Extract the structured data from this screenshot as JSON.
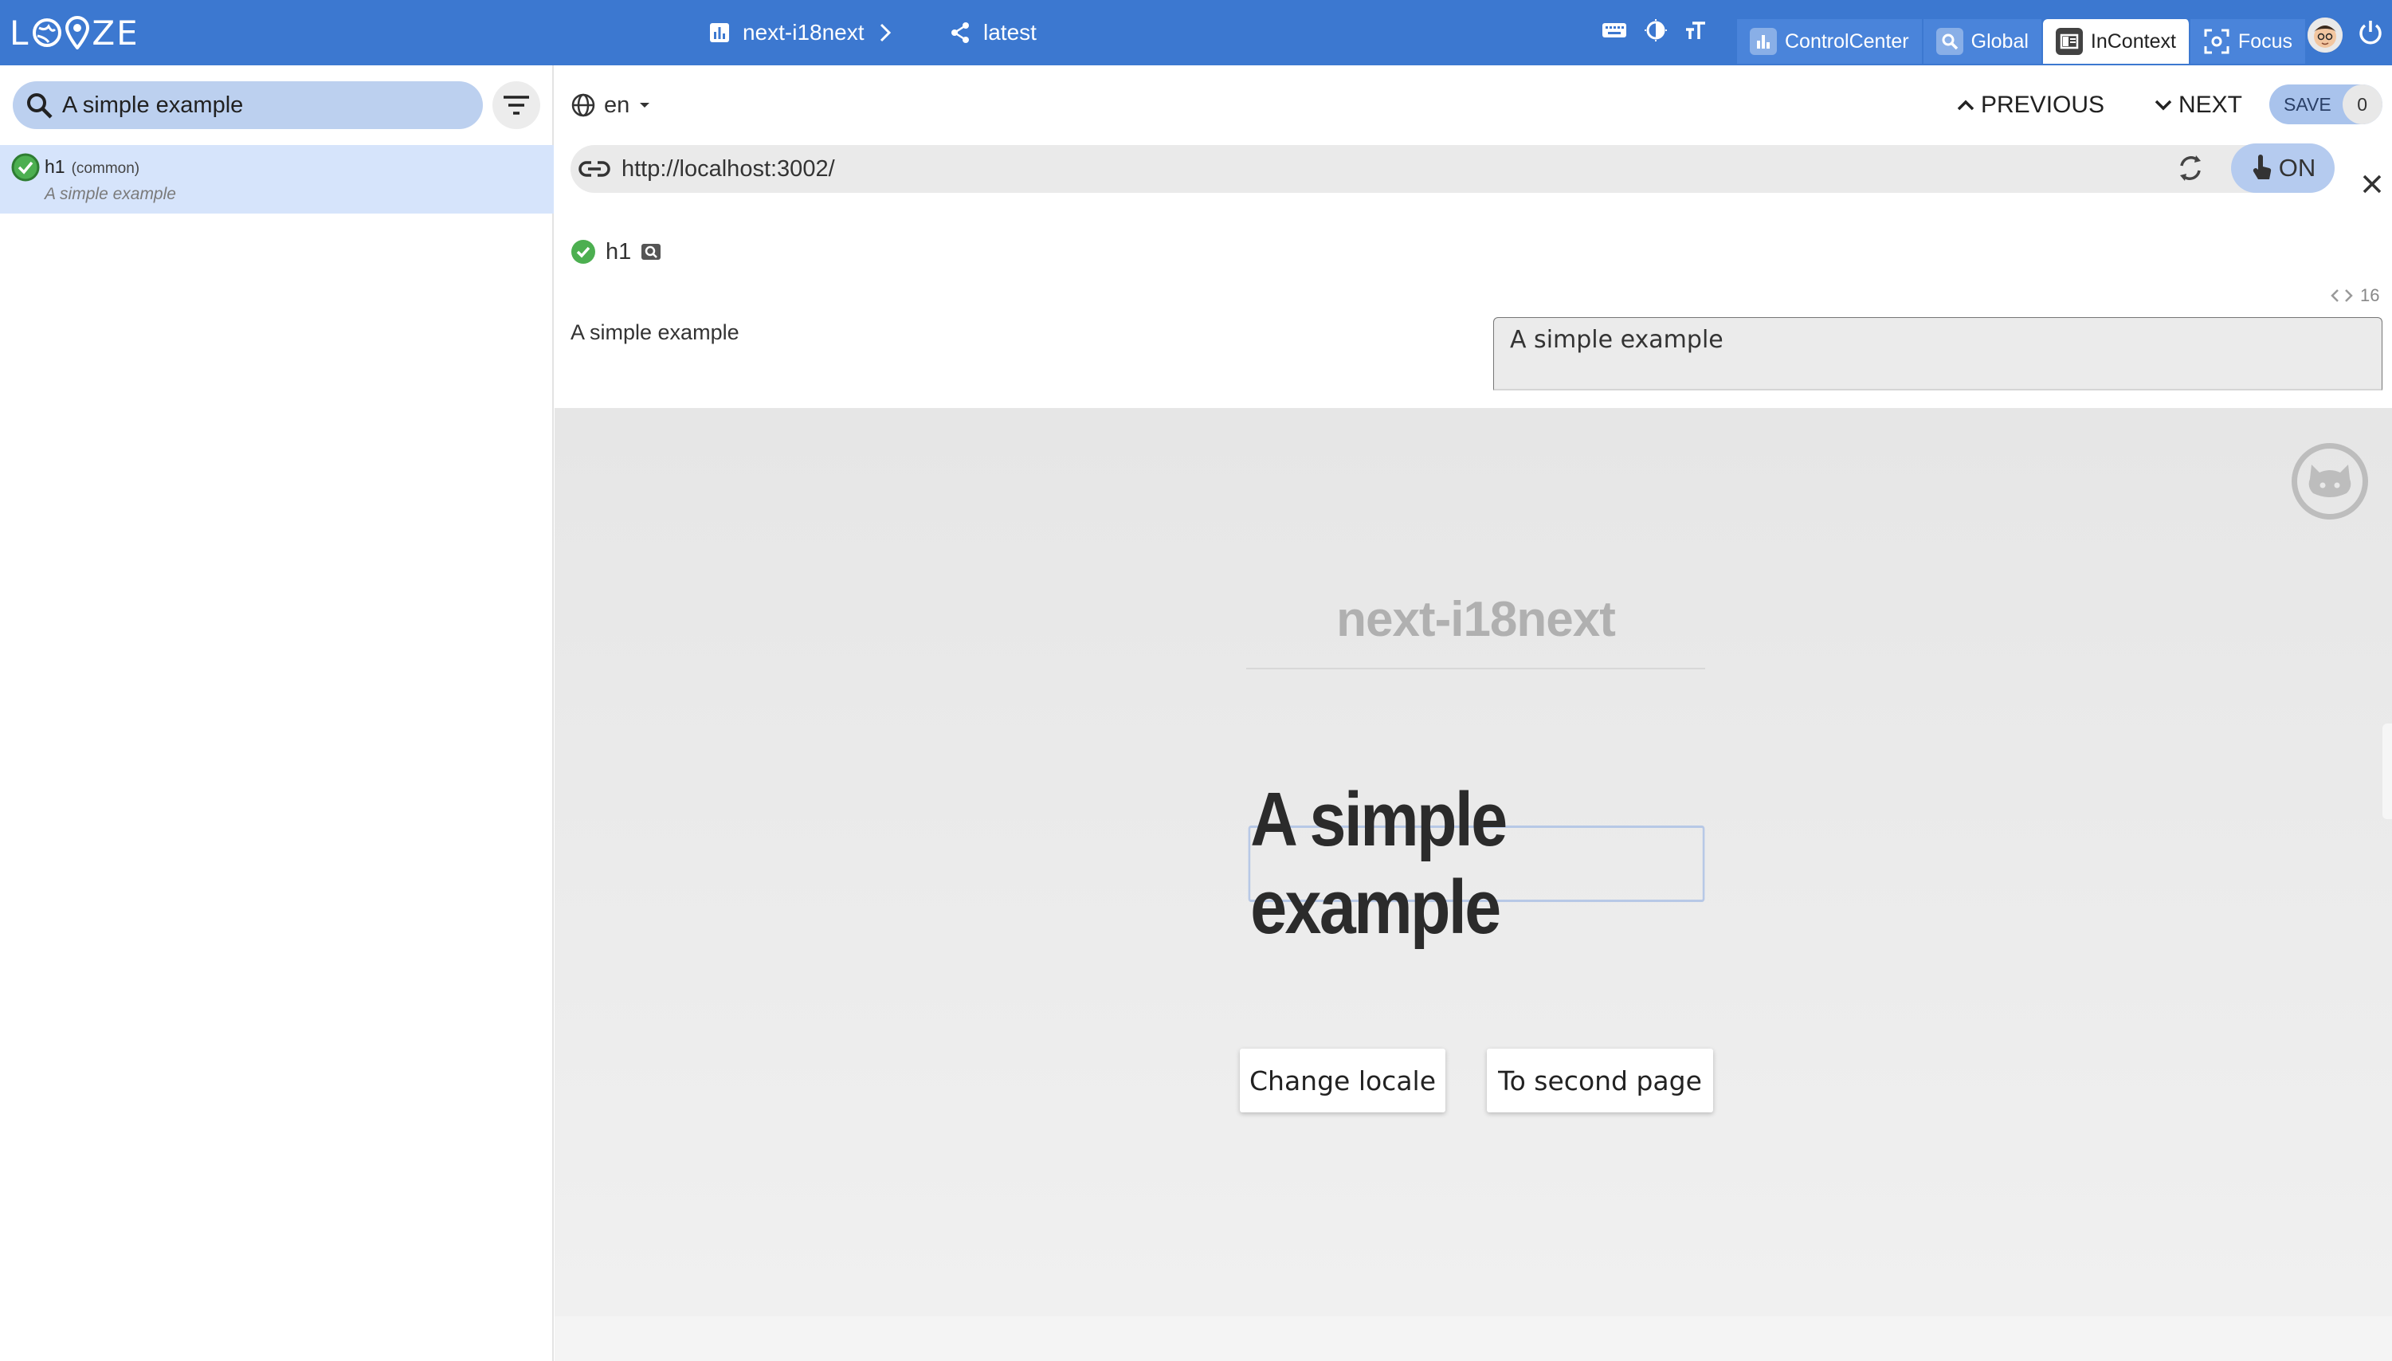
{
  "app": {
    "logo_text": "L  C  ZE"
  },
  "header": {
    "project_name": "next-i18next",
    "version_name": "latest",
    "modes": [
      {
        "label": "ControlCenter",
        "active": false
      },
      {
        "label": "Global",
        "active": false
      },
      {
        "label": "InContext",
        "active": true
      },
      {
        "label": "Focus",
        "active": false
      }
    ]
  },
  "sidebar": {
    "search_value": "A simple example",
    "keys": [
      {
        "key": "h1",
        "namespace": "(common)",
        "value": "A simple example",
        "status": "translated"
      }
    ]
  },
  "toolbar": {
    "language": "en",
    "previous_label": "PREVIOUS",
    "next_label": "NEXT",
    "save_label": "SAVE",
    "save_count": "0"
  },
  "urlbar": {
    "url": "http://localhost:3002/",
    "toggle_label": "ON"
  },
  "editor": {
    "key": "h1",
    "char_count": "16",
    "reference_value": "A simple example",
    "value": "A simple example"
  },
  "preview": {
    "site_title": "next-i18next",
    "headline": "A simple example",
    "buttons": [
      "Change locale",
      "To second page"
    ]
  },
  "colors": {
    "topbar": "#3c78d0",
    "selection": "#d6e4fb",
    "success": "#4caf50"
  }
}
